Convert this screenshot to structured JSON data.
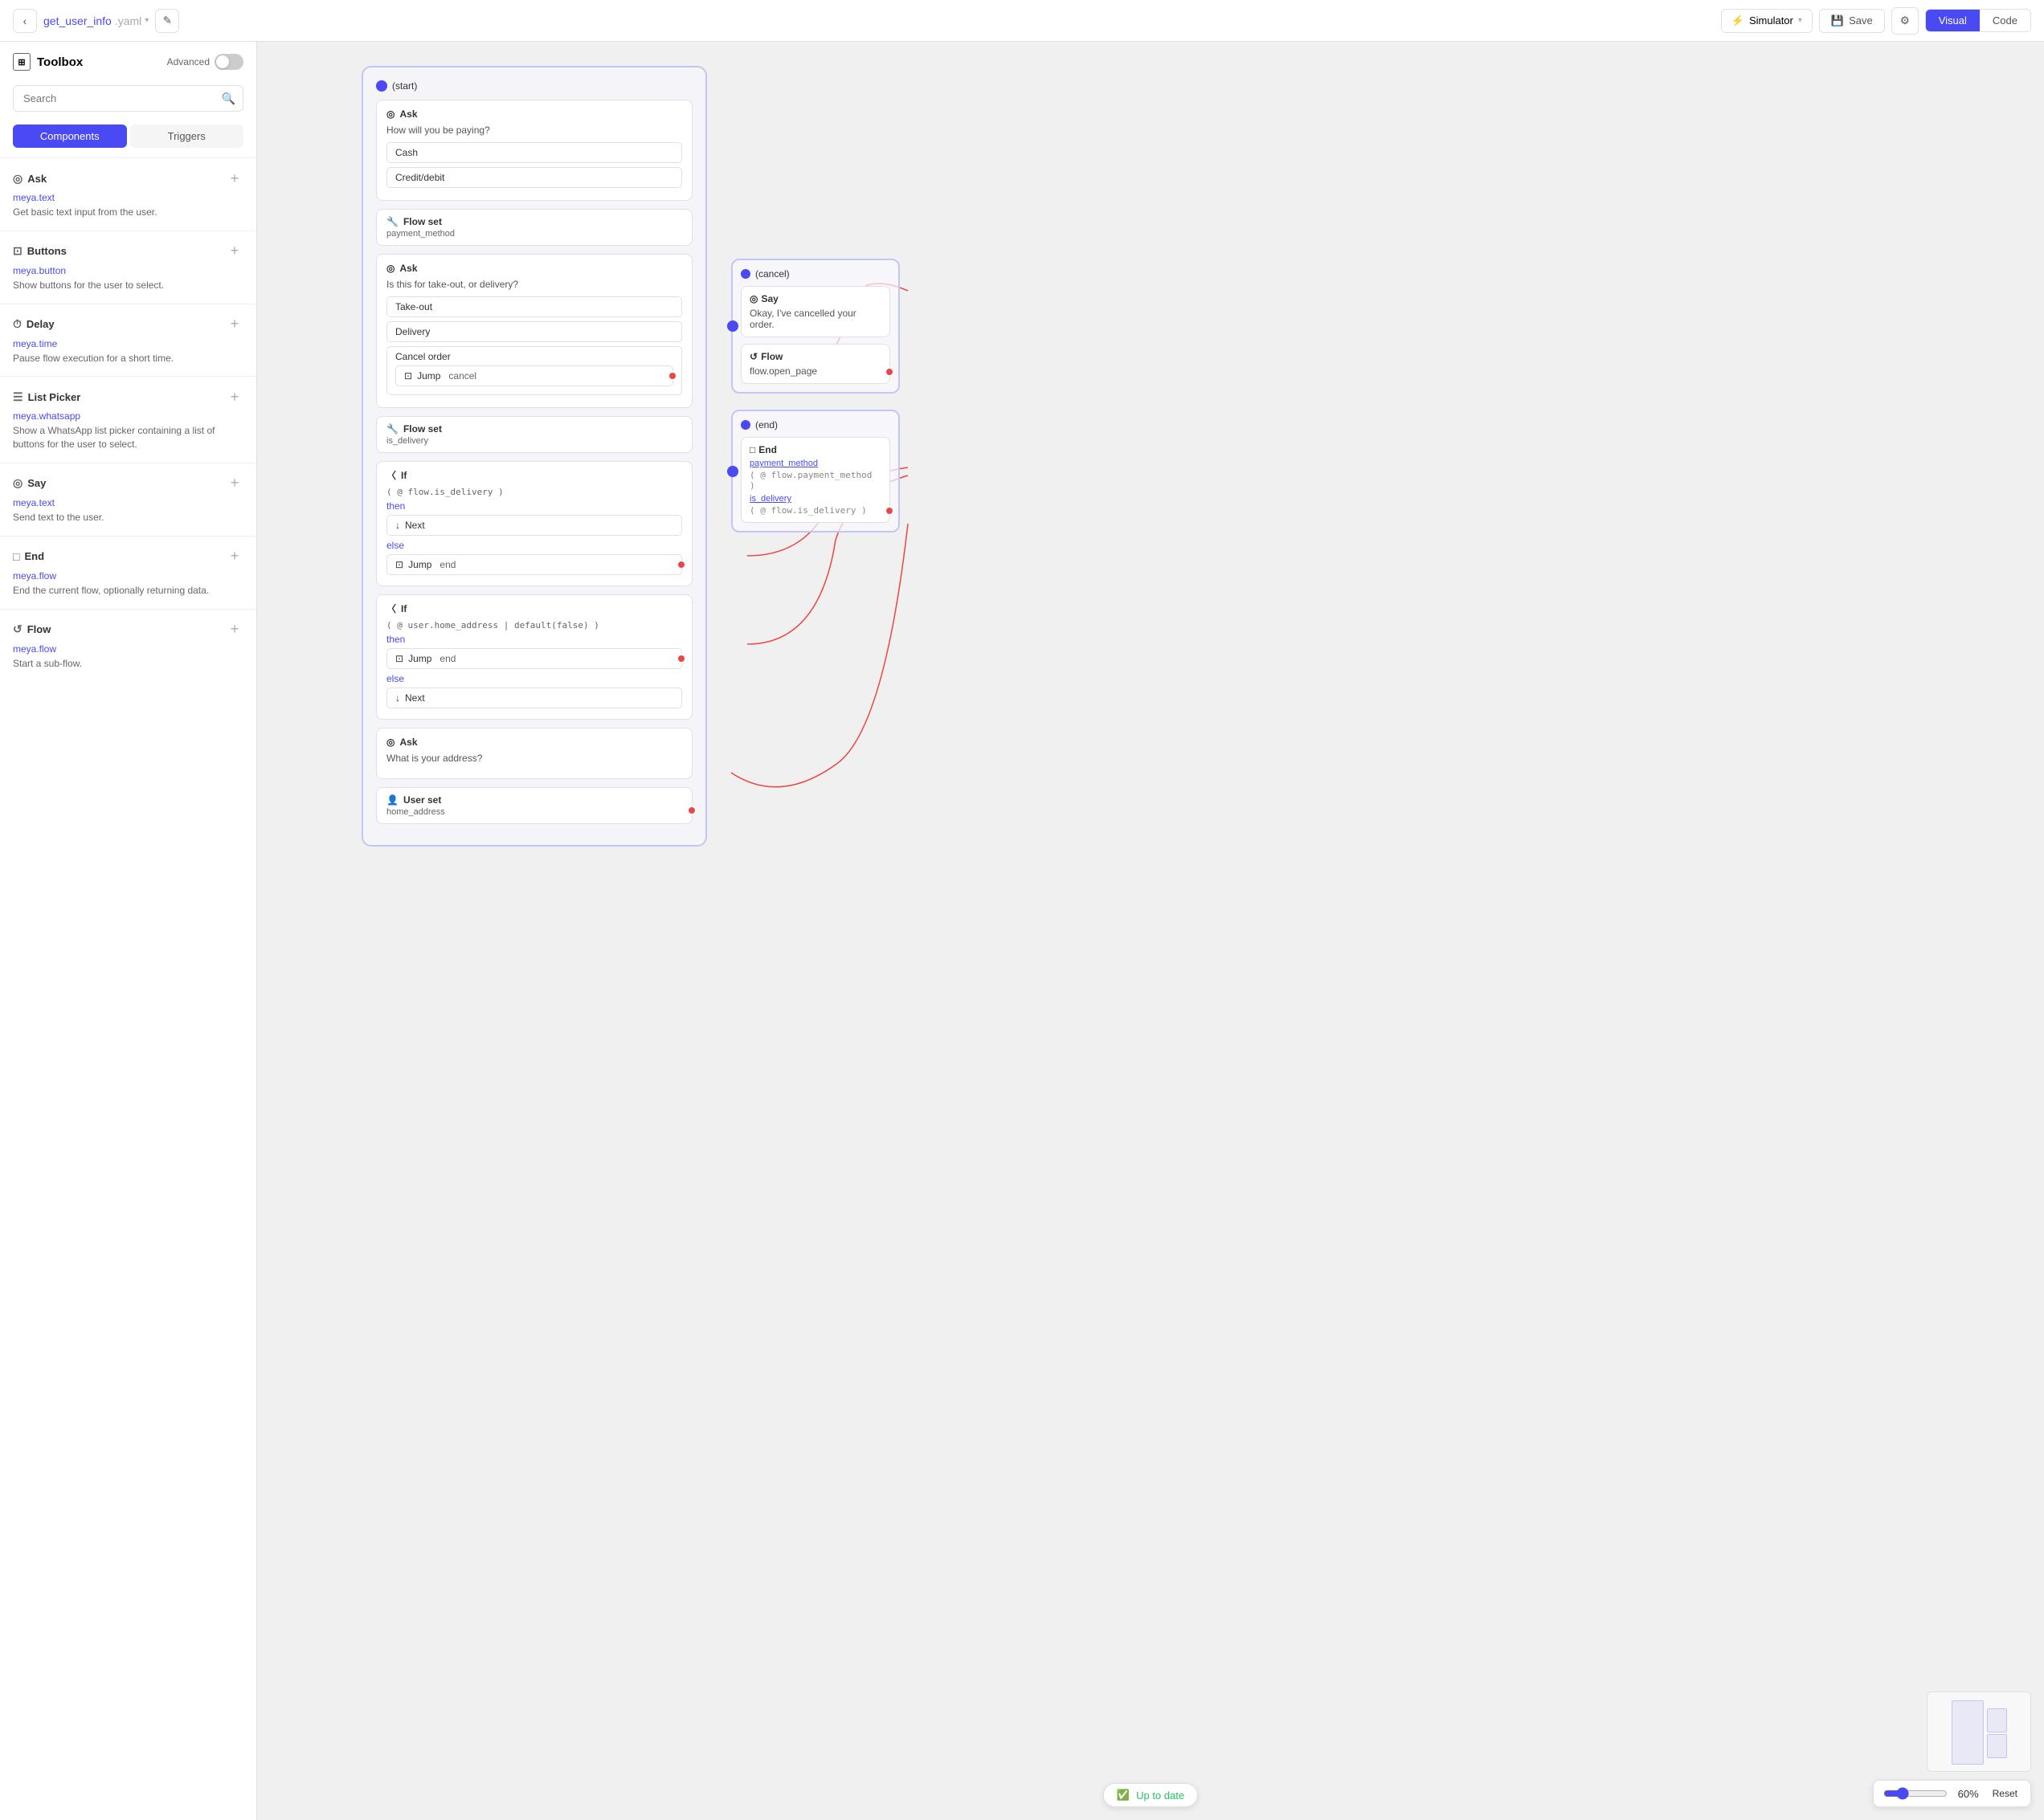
{
  "topbar": {
    "back_label": "‹",
    "filename": "get_user_info",
    "filename_ext": ".yaml",
    "chevron": "▾",
    "edit_icon": "✎",
    "simulator_label": "Simulator",
    "simulator_chevron": "▾",
    "save_label": "Save",
    "view_visual": "Visual",
    "view_code": "Code"
  },
  "toolbox": {
    "title": "Toolbox",
    "advanced_label": "Advanced",
    "search_placeholder": "Search",
    "tab_components": "Components",
    "tab_triggers": "Triggers",
    "sections": [
      {
        "id": "ask",
        "icon": "◎",
        "title": "Ask",
        "link": "meya.text",
        "desc": "Get basic text input from the user."
      },
      {
        "id": "buttons",
        "icon": "⊡",
        "title": "Buttons",
        "link": "meya.button",
        "desc": "Show buttons for the user to select."
      },
      {
        "id": "delay",
        "icon": "⏱",
        "title": "Delay",
        "link": "meya.time",
        "desc": "Pause flow execution for a short time."
      },
      {
        "id": "list-picker",
        "icon": "☰",
        "title": "List Picker",
        "link": "meya.whatsapp",
        "desc": "Show a WhatsApp list picker containing a list of buttons for the user to select."
      },
      {
        "id": "say",
        "icon": "◎",
        "title": "Say",
        "link": "meya.text",
        "desc": "Send text to the user."
      },
      {
        "id": "end",
        "icon": "□",
        "title": "End",
        "link": "meya.flow",
        "desc": "End the current flow, optionally returning data."
      },
      {
        "id": "flow",
        "icon": "↺",
        "title": "Flow",
        "link": "meya.flow",
        "desc": "Start a sub-flow."
      }
    ]
  },
  "canvas": {
    "start_label": "(start)",
    "nodes": {
      "ask1": {
        "header": "Ask",
        "question": "How will you be paying?",
        "options": [
          "Cash",
          "Credit/debit"
        ]
      },
      "flowset1": {
        "header": "Flow set",
        "value": "payment_method"
      },
      "ask2": {
        "header": "Ask",
        "question": "Is this for take-out, or delivery?",
        "options": [
          "Take-out",
          "Delivery"
        ],
        "special": "Cancel order",
        "special_jump": "cancel"
      },
      "flowset2": {
        "header": "Flow set",
        "value": "is_delivery"
      },
      "if1": {
        "header": "If",
        "condition": "( @ flow.is_delivery )",
        "then_label": "then",
        "then_action": "Next",
        "else_label": "else",
        "else_jump": "end"
      },
      "if2": {
        "header": "If",
        "condition": "( @ user.home_address | default(false) )",
        "then_label": "then",
        "then_jump": "end",
        "else_label": "else",
        "else_action": "Next"
      },
      "ask3": {
        "header": "Ask",
        "question": "What is your address?"
      },
      "userset": {
        "header": "User set",
        "value": "home_address"
      }
    },
    "cancel_node": {
      "label": "(cancel)",
      "say_text": "Okay, I've cancelled your order.",
      "flow_text": "flow.open_page"
    },
    "end_node": {
      "label": "(end)",
      "var1_name": "payment_method",
      "var1_val": "( @ flow.payment_method )",
      "var2_name": "is_delivery",
      "var2_val": "( @ flow.is_delivery )"
    },
    "status": "Up to date",
    "zoom": "60%",
    "reset_label": "Reset"
  }
}
